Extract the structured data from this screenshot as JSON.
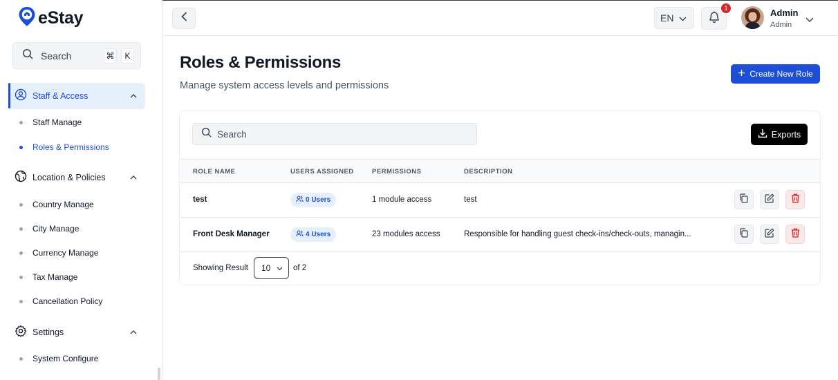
{
  "app": {
    "name": "eStay"
  },
  "sidebar": {
    "search": {
      "label": "Search",
      "kbd_mod": "⌘",
      "kbd_key": "K"
    },
    "groups": [
      {
        "label": "Staff & Access",
        "icon": "user-circle-icon",
        "expanded": true,
        "active": true,
        "items": [
          {
            "label": "Staff Manage",
            "active": false
          },
          {
            "label": "Roles & Permissions",
            "active": true
          }
        ]
      },
      {
        "label": "Location & Policies",
        "icon": "globe-icon",
        "expanded": true,
        "active": false,
        "items": [
          {
            "label": "Country Manage"
          },
          {
            "label": "City Manage"
          },
          {
            "label": "Currency Manage"
          },
          {
            "label": "Tax Manage"
          },
          {
            "label": "Cancellation Policy"
          }
        ]
      },
      {
        "label": "Settings",
        "icon": "gear-icon",
        "expanded": true,
        "active": false,
        "items": [
          {
            "label": "System Configure"
          }
        ]
      }
    ]
  },
  "header": {
    "language": "EN",
    "notification_count": "1",
    "user": {
      "name": "Admin",
      "role": "Admin"
    }
  },
  "main": {
    "title": "Roles & Permissions",
    "subtitle": "Manage system access levels and permissions",
    "create_button": "Create New Role",
    "table": {
      "search_placeholder": "Search",
      "export_label": "Exports",
      "columns": [
        "ROLE NAME",
        "USERS ASSIGNED",
        "PERMISSIONS",
        "DESCRIPTION"
      ],
      "rows": [
        {
          "role": "test",
          "users": "0 Users",
          "permissions": "1 module access",
          "description": "test"
        },
        {
          "role": "Front Desk Manager",
          "users": "4 Users",
          "permissions": "23 modules access",
          "description": "Responsible for handling guest check-ins/check-outs, managin..."
        }
      ],
      "footer": {
        "showing_label": "Showing Result",
        "per_page": "10",
        "total_label": "of 2"
      }
    }
  },
  "colors": {
    "accent": "#1d4ed8",
    "accent_bg": "#e6effc",
    "danger": "#dc2626",
    "black": "#000000"
  }
}
